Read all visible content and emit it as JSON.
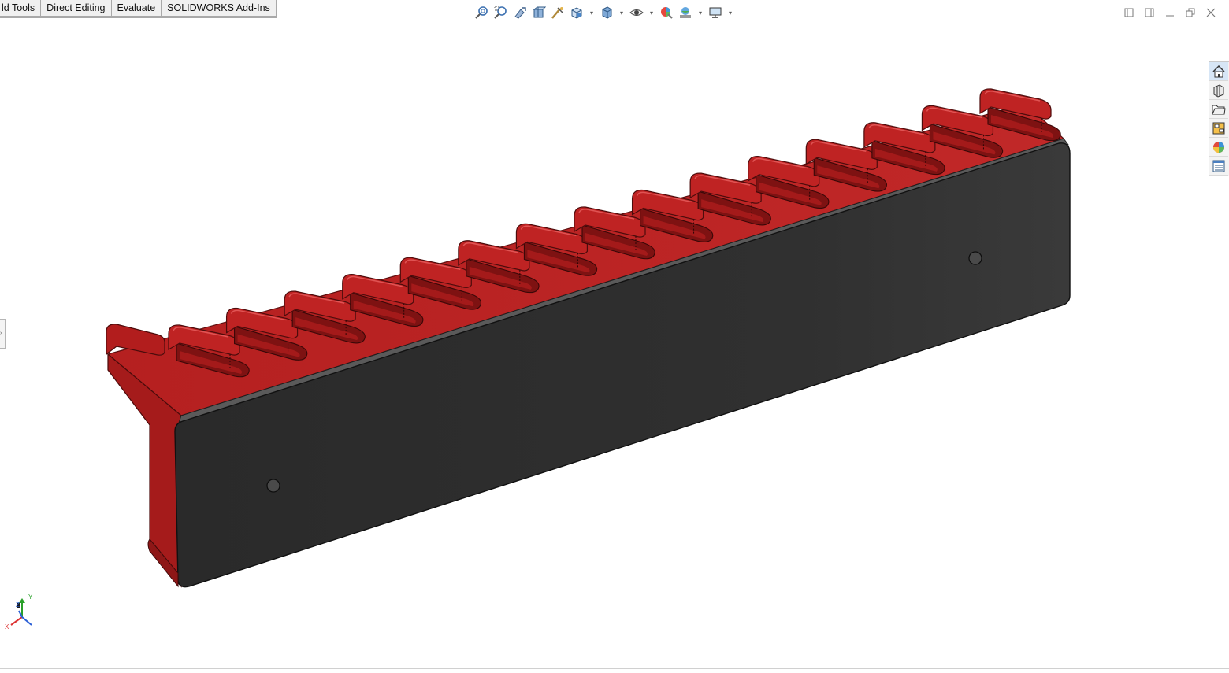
{
  "command_manager": {
    "tabs": [
      {
        "label": "ld Tools"
      },
      {
        "label": "Direct Editing"
      },
      {
        "label": "Evaluate"
      },
      {
        "label": "SOLIDWORKS Add-Ins"
      }
    ]
  },
  "heads_up_toolbar": {
    "icons": [
      "zoom-to-fit-icon",
      "zoom-to-area-icon",
      "previous-view-icon",
      "section-view-icon",
      "dynamic-annotation-icon",
      "view-orientation-icon",
      "display-style-icon",
      "hide-show-items-icon",
      "edit-appearance-icon",
      "apply-scene-icon",
      "view-settings-icon"
    ]
  },
  "window_controls": [
    "tile-left-icon",
    "tile-right-icon",
    "minimize-icon",
    "restore-icon",
    "close-icon"
  ],
  "task_pane": {
    "icons": [
      "solidworks-resources-icon",
      "design-library-icon",
      "file-explorer-icon",
      "view-palette-icon",
      "appearances-scenes-icon",
      "custom-properties-icon"
    ]
  },
  "model": {
    "body_color": "#b8201f",
    "face_color": "#2d2d2d",
    "slot_count": 15
  },
  "triad": {
    "x": "X",
    "y": "Y",
    "z": "Z"
  }
}
